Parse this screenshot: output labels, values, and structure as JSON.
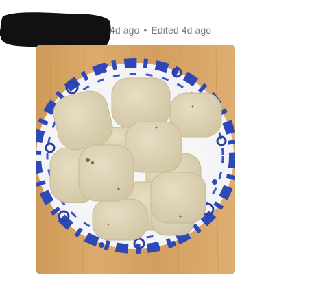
{
  "post": {
    "author_redacted": true,
    "posted_ago": "4d ago",
    "separator": "•",
    "edited_label": "Edited 4d ago"
  },
  "image": {
    "subject": "plate-of-shortbread-cookies",
    "colors": {
      "table_wood": "#d7a463",
      "plate_white": "#f4f4f6",
      "plate_pattern_blue": "#2f48b8",
      "cookie": "#ddd3b6",
      "redaction": "#111111",
      "meta_text": "#7a7a7a"
    }
  }
}
